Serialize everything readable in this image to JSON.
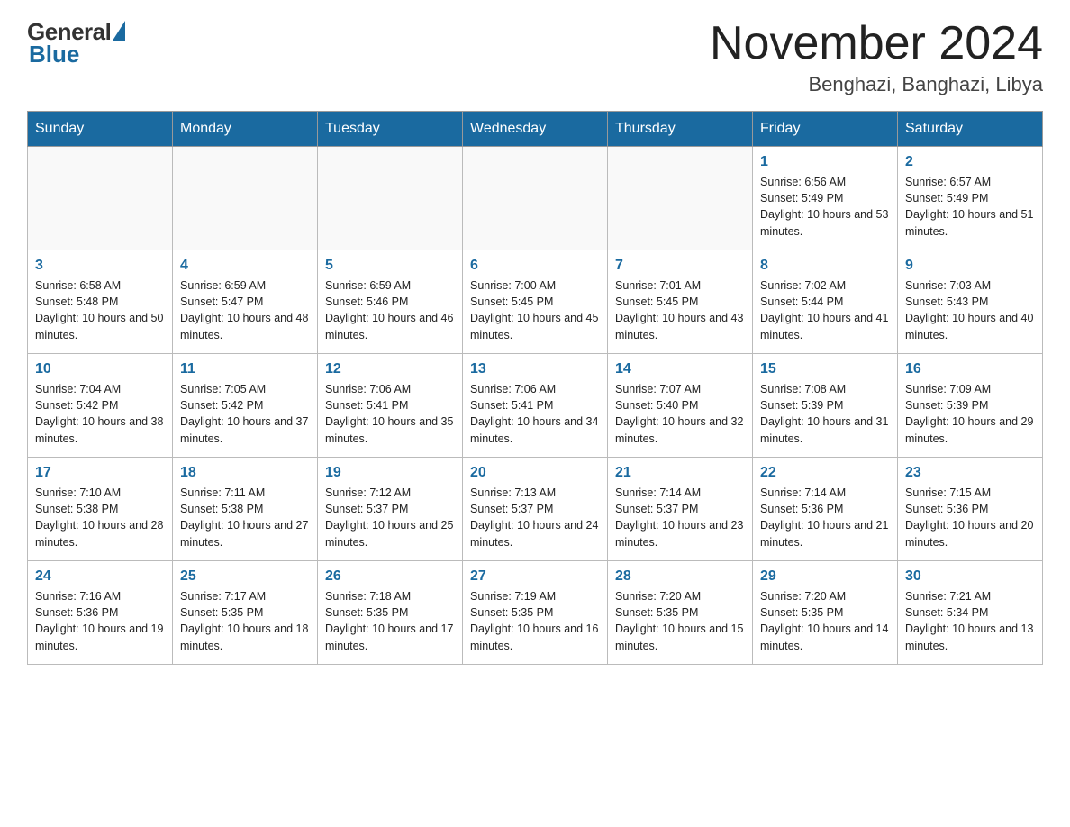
{
  "logo": {
    "general": "General",
    "blue": "Blue"
  },
  "header": {
    "title": "November 2024",
    "subtitle": "Benghazi, Banghazi, Libya"
  },
  "weekdays": [
    "Sunday",
    "Monday",
    "Tuesday",
    "Wednesday",
    "Thursday",
    "Friday",
    "Saturday"
  ],
  "weeks": [
    [
      {
        "day": "",
        "info": ""
      },
      {
        "day": "",
        "info": ""
      },
      {
        "day": "",
        "info": ""
      },
      {
        "day": "",
        "info": ""
      },
      {
        "day": "",
        "info": ""
      },
      {
        "day": "1",
        "info": "Sunrise: 6:56 AM\nSunset: 5:49 PM\nDaylight: 10 hours and 53 minutes."
      },
      {
        "day": "2",
        "info": "Sunrise: 6:57 AM\nSunset: 5:49 PM\nDaylight: 10 hours and 51 minutes."
      }
    ],
    [
      {
        "day": "3",
        "info": "Sunrise: 6:58 AM\nSunset: 5:48 PM\nDaylight: 10 hours and 50 minutes."
      },
      {
        "day": "4",
        "info": "Sunrise: 6:59 AM\nSunset: 5:47 PM\nDaylight: 10 hours and 48 minutes."
      },
      {
        "day": "5",
        "info": "Sunrise: 6:59 AM\nSunset: 5:46 PM\nDaylight: 10 hours and 46 minutes."
      },
      {
        "day": "6",
        "info": "Sunrise: 7:00 AM\nSunset: 5:45 PM\nDaylight: 10 hours and 45 minutes."
      },
      {
        "day": "7",
        "info": "Sunrise: 7:01 AM\nSunset: 5:45 PM\nDaylight: 10 hours and 43 minutes."
      },
      {
        "day": "8",
        "info": "Sunrise: 7:02 AM\nSunset: 5:44 PM\nDaylight: 10 hours and 41 minutes."
      },
      {
        "day": "9",
        "info": "Sunrise: 7:03 AM\nSunset: 5:43 PM\nDaylight: 10 hours and 40 minutes."
      }
    ],
    [
      {
        "day": "10",
        "info": "Sunrise: 7:04 AM\nSunset: 5:42 PM\nDaylight: 10 hours and 38 minutes."
      },
      {
        "day": "11",
        "info": "Sunrise: 7:05 AM\nSunset: 5:42 PM\nDaylight: 10 hours and 37 minutes."
      },
      {
        "day": "12",
        "info": "Sunrise: 7:06 AM\nSunset: 5:41 PM\nDaylight: 10 hours and 35 minutes."
      },
      {
        "day": "13",
        "info": "Sunrise: 7:06 AM\nSunset: 5:41 PM\nDaylight: 10 hours and 34 minutes."
      },
      {
        "day": "14",
        "info": "Sunrise: 7:07 AM\nSunset: 5:40 PM\nDaylight: 10 hours and 32 minutes."
      },
      {
        "day": "15",
        "info": "Sunrise: 7:08 AM\nSunset: 5:39 PM\nDaylight: 10 hours and 31 minutes."
      },
      {
        "day": "16",
        "info": "Sunrise: 7:09 AM\nSunset: 5:39 PM\nDaylight: 10 hours and 29 minutes."
      }
    ],
    [
      {
        "day": "17",
        "info": "Sunrise: 7:10 AM\nSunset: 5:38 PM\nDaylight: 10 hours and 28 minutes."
      },
      {
        "day": "18",
        "info": "Sunrise: 7:11 AM\nSunset: 5:38 PM\nDaylight: 10 hours and 27 minutes."
      },
      {
        "day": "19",
        "info": "Sunrise: 7:12 AM\nSunset: 5:37 PM\nDaylight: 10 hours and 25 minutes."
      },
      {
        "day": "20",
        "info": "Sunrise: 7:13 AM\nSunset: 5:37 PM\nDaylight: 10 hours and 24 minutes."
      },
      {
        "day": "21",
        "info": "Sunrise: 7:14 AM\nSunset: 5:37 PM\nDaylight: 10 hours and 23 minutes."
      },
      {
        "day": "22",
        "info": "Sunrise: 7:14 AM\nSunset: 5:36 PM\nDaylight: 10 hours and 21 minutes."
      },
      {
        "day": "23",
        "info": "Sunrise: 7:15 AM\nSunset: 5:36 PM\nDaylight: 10 hours and 20 minutes."
      }
    ],
    [
      {
        "day": "24",
        "info": "Sunrise: 7:16 AM\nSunset: 5:36 PM\nDaylight: 10 hours and 19 minutes."
      },
      {
        "day": "25",
        "info": "Sunrise: 7:17 AM\nSunset: 5:35 PM\nDaylight: 10 hours and 18 minutes."
      },
      {
        "day": "26",
        "info": "Sunrise: 7:18 AM\nSunset: 5:35 PM\nDaylight: 10 hours and 17 minutes."
      },
      {
        "day": "27",
        "info": "Sunrise: 7:19 AM\nSunset: 5:35 PM\nDaylight: 10 hours and 16 minutes."
      },
      {
        "day": "28",
        "info": "Sunrise: 7:20 AM\nSunset: 5:35 PM\nDaylight: 10 hours and 15 minutes."
      },
      {
        "day": "29",
        "info": "Sunrise: 7:20 AM\nSunset: 5:35 PM\nDaylight: 10 hours and 14 minutes."
      },
      {
        "day": "30",
        "info": "Sunrise: 7:21 AM\nSunset: 5:34 PM\nDaylight: 10 hours and 13 minutes."
      }
    ]
  ]
}
